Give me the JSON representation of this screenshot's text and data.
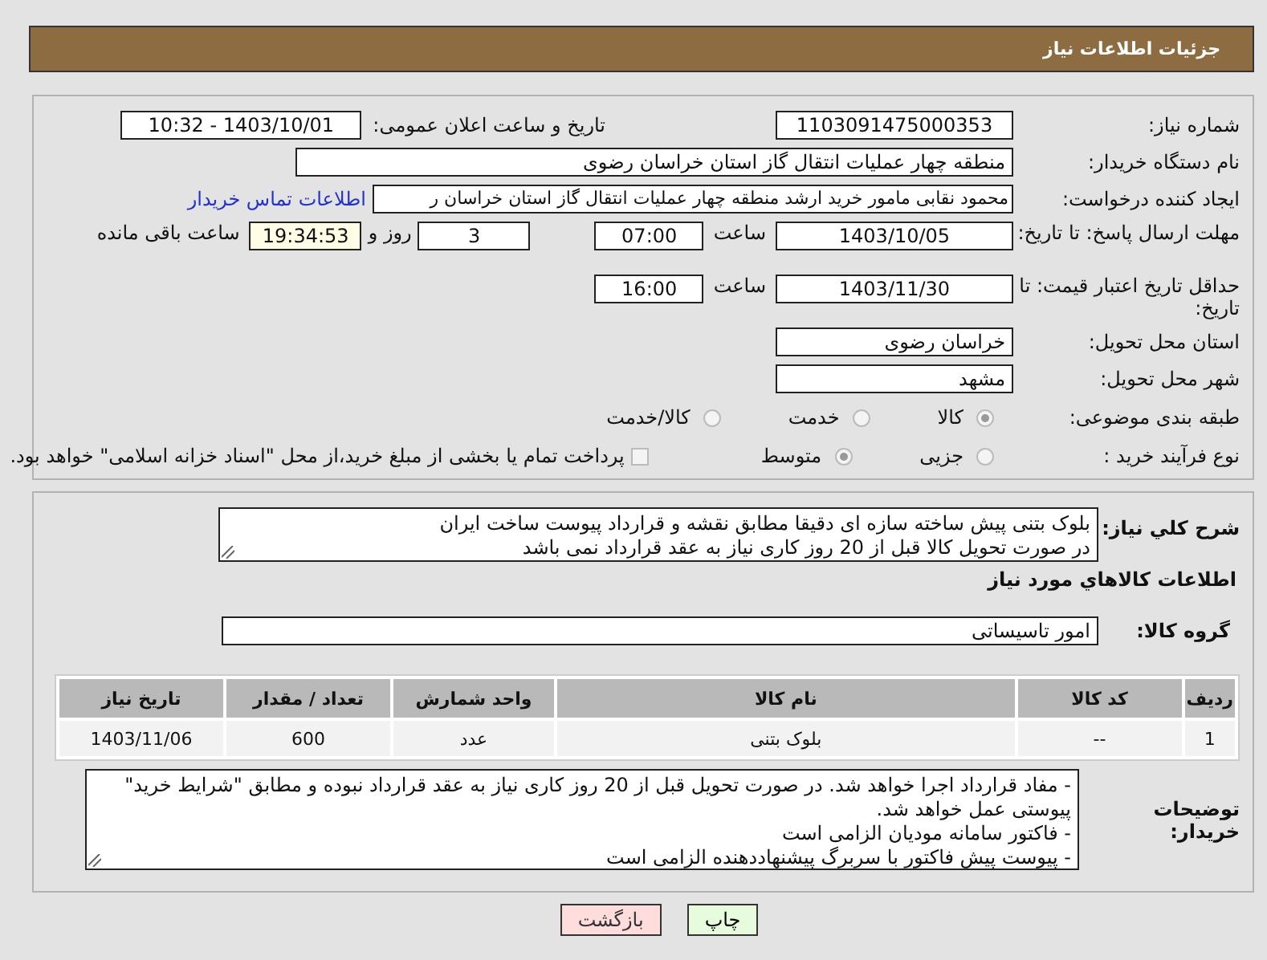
{
  "header": {
    "title": "جزئیات اطلاعات نیاز"
  },
  "need_number": {
    "label": "شماره نیاز:",
    "value": "1103091475000353"
  },
  "announce": {
    "label": "تاریخ و ساعت اعلان عمومی:",
    "value": "1403/10/01 - 10:32"
  },
  "buyer": {
    "label": "نام دستگاه خریدار:",
    "value": "منطقه چهار عملیات انتقال گاز   استان خراسان رضوی"
  },
  "requester": {
    "label": "ایجاد کننده درخواست:",
    "value": "محمود نقابی مامور خرید ارشد منطقه چهار عملیات انتقال گاز   استان خراسان ر",
    "link": "اطلاعات تماس خریدار"
  },
  "reply_deadline": {
    "label": "مهلت ارسال پاسخ: تا تاریخ:",
    "date": "1403/10/05",
    "time_label": "ساعت",
    "time": "07:00",
    "days": "3",
    "days_label": "روز و",
    "remaining": "19:34:53",
    "remaining_label": "ساعت باقی مانده"
  },
  "price_validity": {
    "label": "حداقل تاریخ اعتبار قیمت: تا تاریخ:",
    "date": "1403/11/30",
    "time_label": "ساعت",
    "time": "16:00"
  },
  "province": {
    "label": "استان محل تحویل:",
    "value": "خراسان رضوی"
  },
  "city": {
    "label": "شهر محل تحویل:",
    "value": "مشهد"
  },
  "category": {
    "label": "طبقه بندی موضوعی:",
    "options": [
      {
        "label": "کالا",
        "selected": true
      },
      {
        "label": "خدمت",
        "selected": false
      },
      {
        "label": "کالا/خدمت",
        "selected": false
      }
    ]
  },
  "process": {
    "label": "نوع فرآیند خرید :",
    "options": [
      {
        "label": "جزیی",
        "selected": false
      },
      {
        "label": "متوسط",
        "selected": true
      }
    ],
    "payment": {
      "label": "پرداخت تمام یا بخشی از مبلغ خرید،از محل \"اسناد خزانه اسلامی\" خواهد بود.",
      "checked": false
    }
  },
  "description": {
    "label": "شرح کلي نياز:",
    "lines": [
      "بلوک بتنی پیش ساخته سازه ای دقیقا مطابق نقشه و قرارداد پیوست ساخت ایران",
      "در صورت تحویل کالا قبل از 20 روز کاری نیاز به عقد قرارداد نمی باشد"
    ]
  },
  "goods_heading": "اطلاعات کالاهاي مورد نياز",
  "goods_group": {
    "label": "گروه کالا:",
    "value": "امور تاسیساتی"
  },
  "table": {
    "columns": [
      "رديف",
      "کد کالا",
      "نام کالا",
      "واحد شمارش",
      "تعداد / مقدار",
      "تاریخ نیاز"
    ],
    "rows": [
      [
        "1",
        "--",
        "بلوک بتنی",
        "عدد",
        "600",
        "1403/11/06"
      ]
    ]
  },
  "buyer_notes": {
    "label": "توضیحات خریدار:",
    "lines": [
      "- مفاد قرارداد اجرا خواهد شد. در صورت تحویل قبل از 20 روز کاری نیاز به عقد قرارداد نبوده و مطابق \"شرایط خرید\" پیوستی عمل خواهد شد.",
      "- فاکتور سامانه مودیان الزامی است",
      "- پیوست پیش فاکتور با سربرگ پیشنهاددهنده الزامی است"
    ]
  },
  "buttons": [
    {
      "label": "چاپ",
      "kind": "print"
    },
    {
      "label": "بازگشت",
      "kind": "back"
    }
  ]
}
